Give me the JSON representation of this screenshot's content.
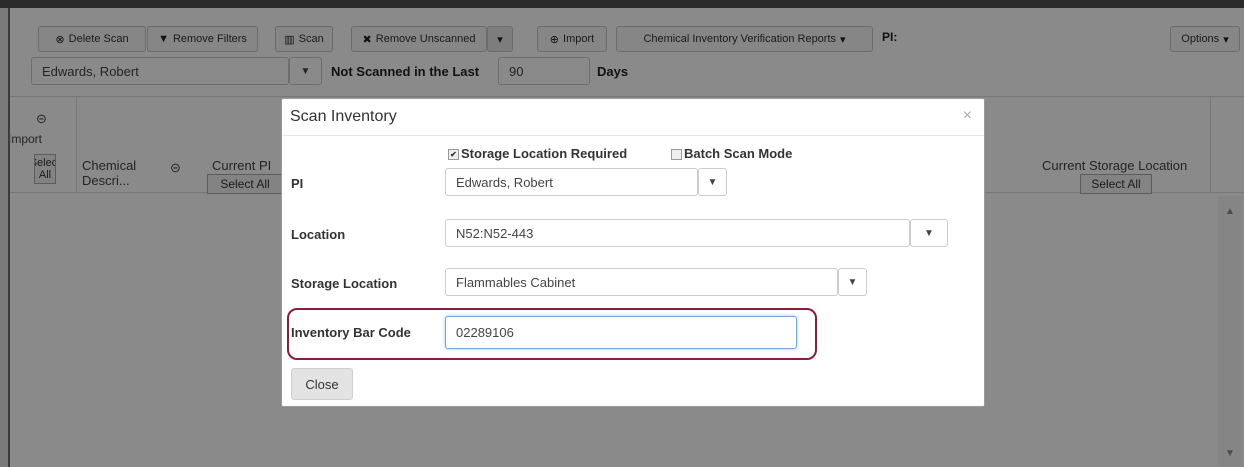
{
  "toolbar": {
    "delete_scan": "Delete Scan",
    "remove_filters": "Remove Filters",
    "scan": "Scan",
    "remove_unscanned": "Remove Unscanned",
    "import": "Import",
    "reports": "Chemical Inventory Verification Reports",
    "pi_label": "PI:",
    "options": "Options"
  },
  "filters": {
    "pi_value": "Edwards, Robert",
    "not_scanned_label": "Not Scanned in the Last",
    "days_value": "90",
    "days_label": "Days"
  },
  "grid": {
    "import_label": "Import",
    "select_all_label": "Select All",
    "chemical_header": "Chemical Descri...",
    "current_pi_header": "Current PI",
    "current_pi_select_all": "Select All",
    "current_storage_header": "Current Storage Location",
    "current_storage_select_all": "Select All"
  },
  "modal": {
    "title": "Scan Inventory",
    "close_x": "×",
    "storage_required_label": "Storage Location Required",
    "storage_required_checked": true,
    "batch_scan_label": "Batch Scan Mode",
    "batch_scan_checked": false,
    "pi_label": "PI",
    "pi_value": "Edwards, Robert",
    "location_label": "Location",
    "location_value": "N52:N52-443",
    "storage_label": "Storage Location",
    "storage_value": "Flammables Cabinet",
    "barcode_label": "Inventory Bar Code",
    "barcode_value": "02289106",
    "close_button": "Close"
  },
  "icons": {
    "delete": "circle-x-icon",
    "filter": "filter-icon",
    "scan": "barcode-icon",
    "remove": "x-icon",
    "import": "circle-arrow-icon",
    "caret": "caret-down-icon"
  },
  "colors": {
    "highlight": "#8b1d3a",
    "overlay": "rgba(0,0,0,0.46)"
  }
}
